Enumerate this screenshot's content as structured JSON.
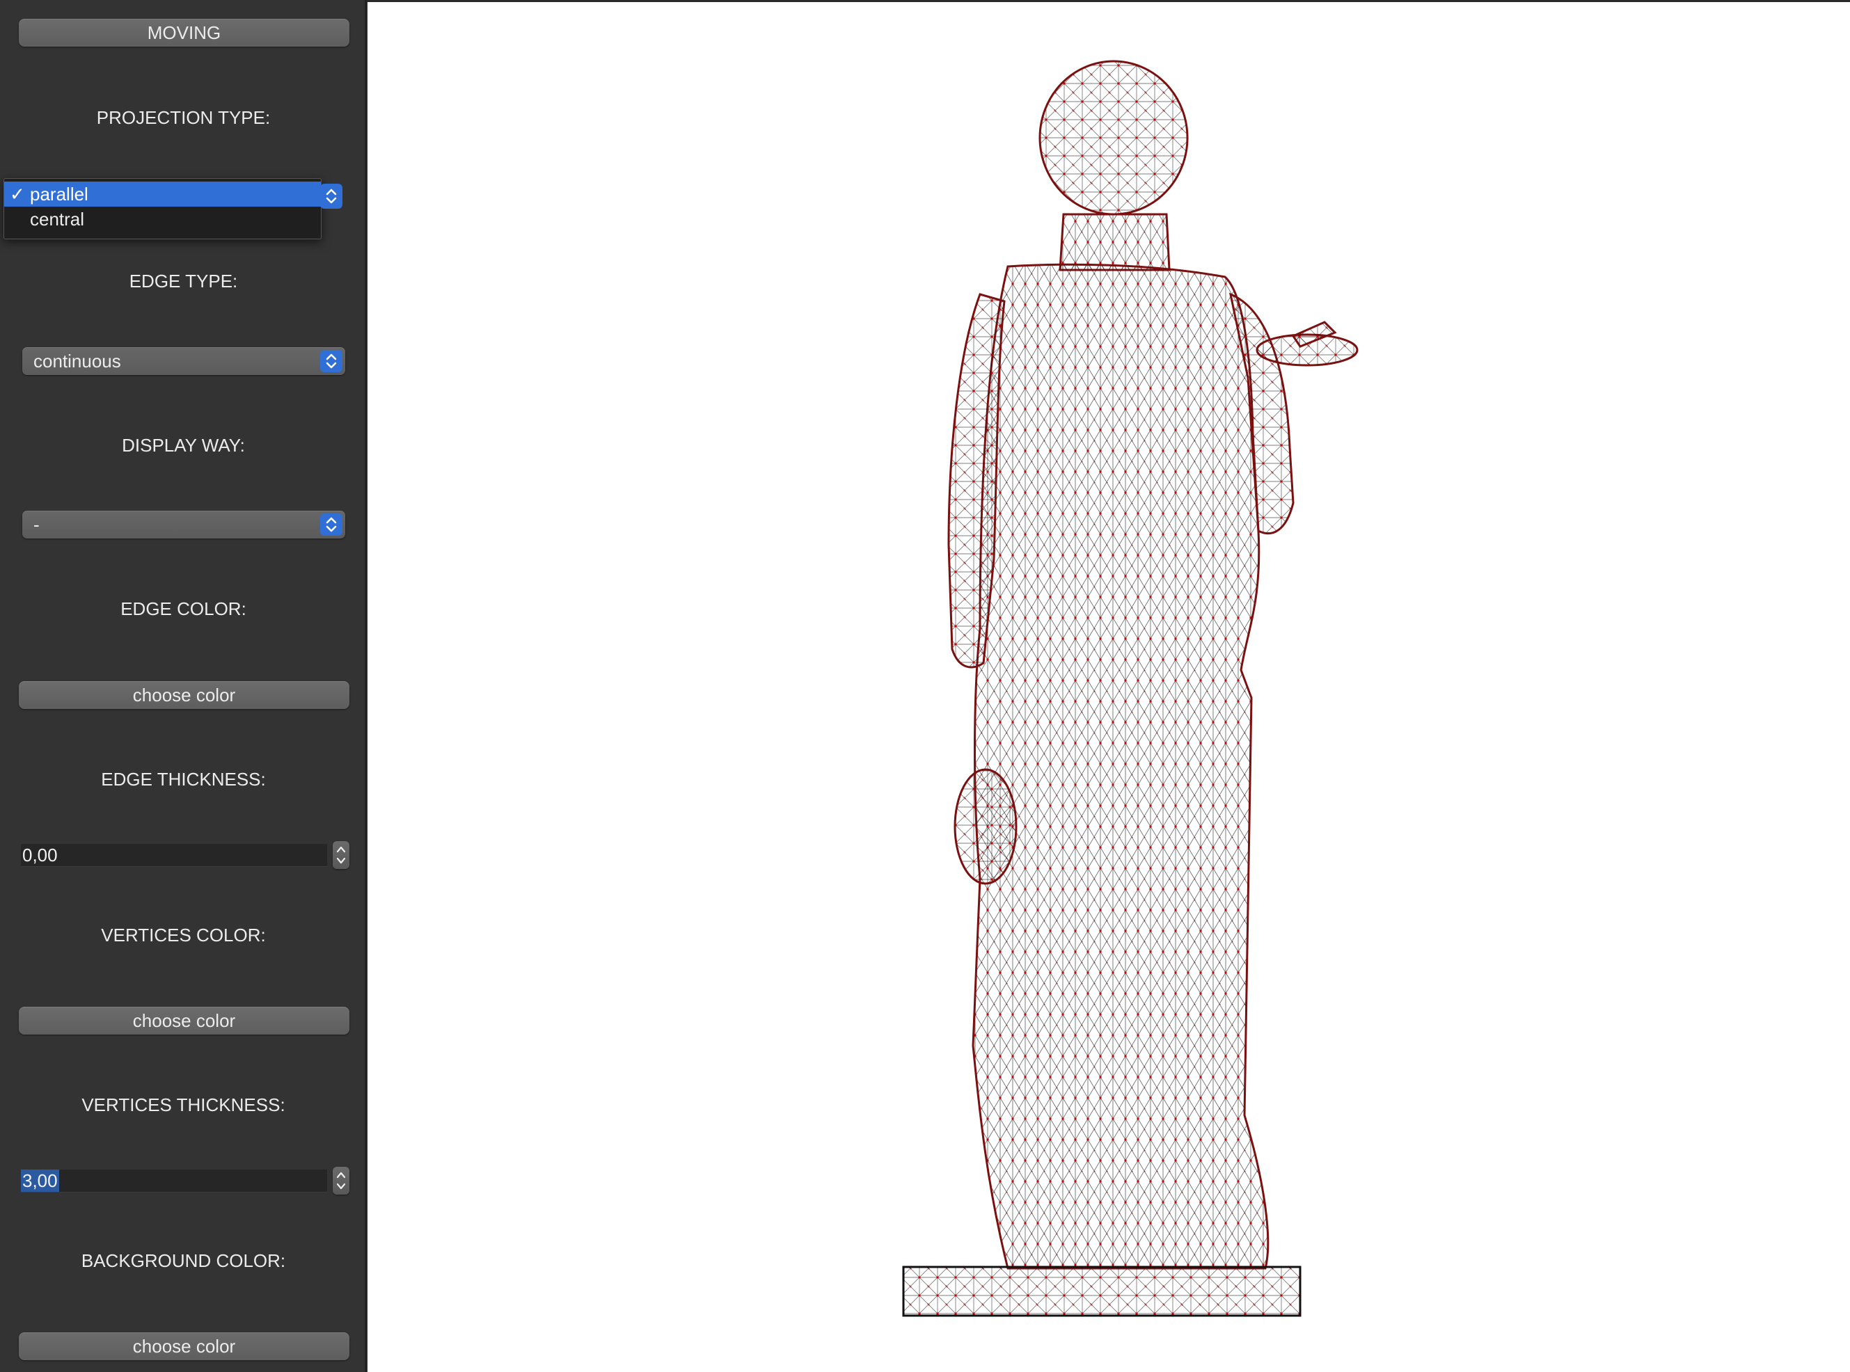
{
  "sidebar": {
    "moving_button": "MOVING",
    "projection_type_label": "PROJECTION TYPE:",
    "projection_options": [
      "parallel",
      "central"
    ],
    "projection_selected": "parallel",
    "edge_type_label": "EDGE  TYPE:",
    "edge_type_value": "continuous",
    "display_way_label": "DISPLAY WAY:",
    "display_way_value": "-",
    "edge_color_label": "EDGE COLOR:",
    "edge_color_button": "choose color",
    "edge_thickness_label": "EDGE THICKNESS:",
    "edge_thickness_value": "0,00",
    "vertices_color_label": "VERTICES  COLOR:",
    "vertices_color_button": "choose color",
    "vertices_thickness_label": "VERTICES THICKNESS:",
    "vertices_thickness_value": "3,00",
    "background_color_label": "BACKGROUND COLOR:",
    "background_color_button": "choose color",
    "check_mark": "✓"
  },
  "viewport": {
    "model": "wireframe-statue",
    "edge_color": "#000000",
    "vertex_color": "#cc0000",
    "background_color": "#ffffff"
  },
  "colors": {
    "accent": "#2f6fd6",
    "panel": "#333333"
  }
}
